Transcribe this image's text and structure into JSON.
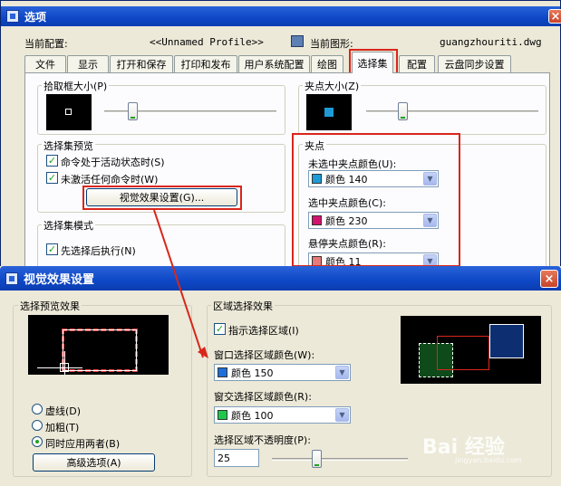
{
  "options_dialog": {
    "title": "选项",
    "current_config_label": "当前配置:",
    "current_config_value": "<<Unnamed Profile>>",
    "current_drawing_label": "当前图形:",
    "current_drawing_value": "guangzhouriti.dwg",
    "tabs": [
      "文件",
      "显示",
      "打开和保存",
      "打印和发布",
      "用户系统配置",
      "绘图",
      "选择集",
      "配置",
      "云盘同步设置"
    ],
    "active_tab": "选择集",
    "pickbox": {
      "title": "拾取框大小(P)"
    },
    "gripsize": {
      "title": "夹点大小(Z)"
    },
    "preview": {
      "title": "选择集预览",
      "opt_command_active": "命令处于活动状态时(S)",
      "opt_no_command": "未激活任何命令时(W)",
      "visual_effects_button": "视觉效果设置(G)..."
    },
    "selection_mode": {
      "title": "选择集模式",
      "opt_noun_verb": "先选择后执行(N)"
    },
    "grips": {
      "title": "夹点",
      "unselected_label": "未选中夹点颜色(U):",
      "unselected_value": "颜色 140",
      "unselected_color": "#1e9bd7",
      "selected_label": "选中夹点颜色(C):",
      "selected_value": "颜色 230",
      "selected_color": "#d2146e",
      "hover_label": "悬停夹点颜色(R):",
      "hover_value": "颜色 11",
      "hover_color": "#e87a7a"
    }
  },
  "visual_dialog": {
    "title": "视觉效果设置",
    "preview_effect": {
      "title": "选择预览效果",
      "radio_dashed": "虚线(D)",
      "radio_thicken": "加粗(T)",
      "radio_both": "同时应用两者(B)",
      "advanced_button": "高级选项(A)"
    },
    "area_effect": {
      "title": "区域选择效果",
      "indicate_area": "指示选择区域(I)",
      "window_color_label": "窗口选择区域颜色(W):",
      "window_color_value": "颜色 150",
      "window_color": "#1e6fd9",
      "crossing_color_label": "窗交选择区域颜色(R):",
      "crossing_color_value": "颜色 100",
      "crossing_color": "#1ec84a",
      "opacity_label": "选择区域不透明度(P):",
      "opacity_value": "25"
    }
  },
  "watermark": {
    "text": "Bai 经验",
    "sub": "jingyan.baidu.com"
  }
}
